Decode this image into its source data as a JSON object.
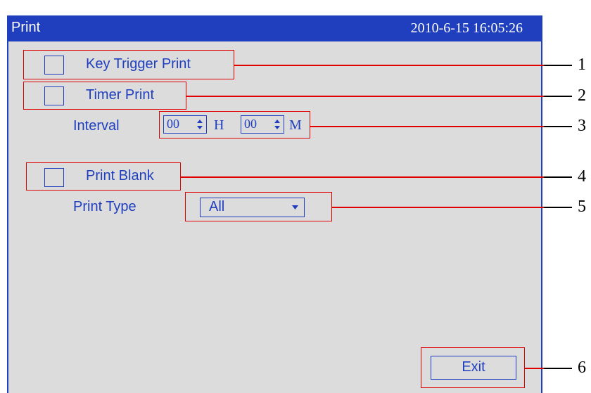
{
  "window": {
    "title": "Print",
    "datetime": "2010-6-15 16:05:26"
  },
  "options": {
    "key_trigger_print": {
      "label": "Key Trigger Print",
      "checked": false
    },
    "timer_print": {
      "label": "Timer Print",
      "checked": false
    },
    "print_blank": {
      "label": "Print Blank",
      "checked": false
    }
  },
  "interval": {
    "label": "Interval",
    "hours_value": "00",
    "hours_unit": "H",
    "minutes_value": "00",
    "minutes_unit": "M"
  },
  "print_type": {
    "label": "Print Type",
    "selected": "All"
  },
  "buttons": {
    "exit_label": "Exit"
  },
  "callouts": [
    "1",
    "2",
    "3",
    "4",
    "5",
    "6"
  ],
  "colors": {
    "accent": "#1f3fbf",
    "panel_bg": "#dcdcdc",
    "annotation": "#e00000"
  },
  "icons": {
    "spinner": "up-down-arrows-icon",
    "dropdown": "chevron-down-icon"
  }
}
